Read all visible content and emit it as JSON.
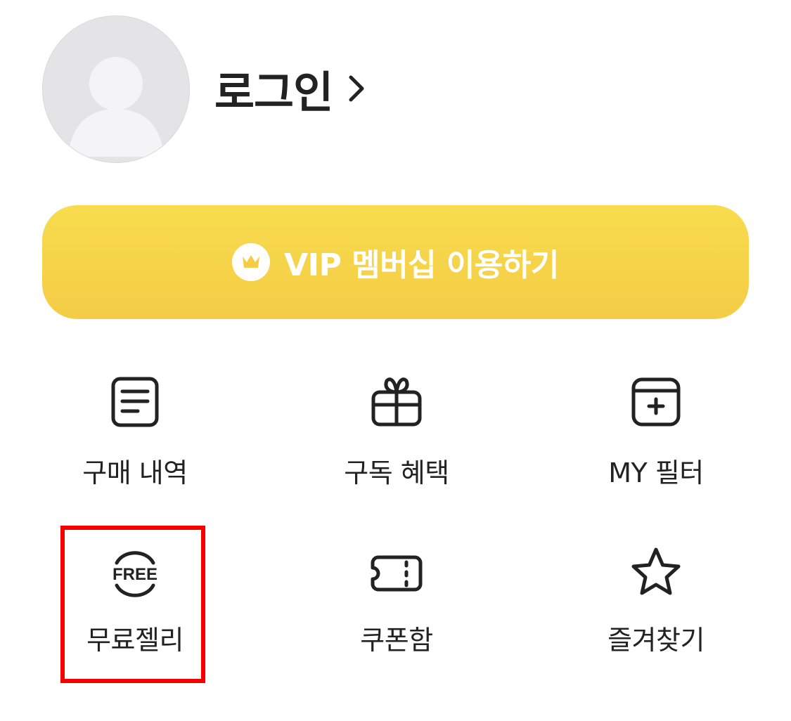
{
  "profile": {
    "login_label": "로그인"
  },
  "vip": {
    "label": "VIP 멤버십 이용하기",
    "color": "#f6d248",
    "icon": "crown-icon"
  },
  "menu": [
    {
      "label": "구매 내역",
      "icon": "receipt-list-icon"
    },
    {
      "label": "구독 혜택",
      "icon": "gift-icon"
    },
    {
      "label": "MY 필터",
      "icon": "calendar-plus-icon"
    },
    {
      "label": "무료젤리",
      "icon": "free-badge-icon",
      "badge_text": "FREE",
      "highlighted": true
    },
    {
      "label": "쿠폰함",
      "icon": "ticket-icon"
    },
    {
      "label": "즐겨찾기",
      "icon": "star-icon"
    }
  ],
  "highlight_color": "#f80000"
}
